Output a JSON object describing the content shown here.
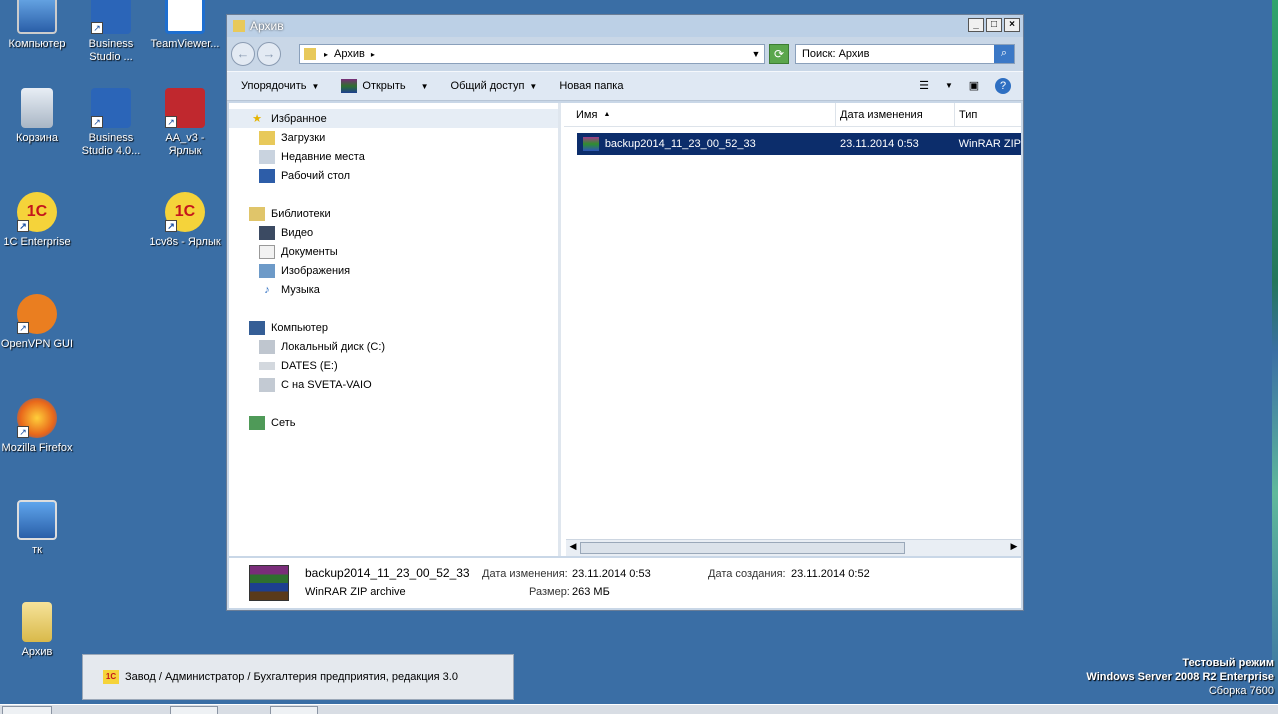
{
  "desktop": {
    "icons": [
      {
        "label": "Компьютер",
        "icon": "computer-icon"
      },
      {
        "label": "Business Studio ...",
        "icon": "business-studio-icon"
      },
      {
        "label": "TeamViewer...",
        "icon": "teamviewer-icon"
      },
      {
        "label": "Корзина",
        "icon": "recycle-bin-icon"
      },
      {
        "label": "Business Studio 4.0...",
        "icon": "business-studio-icon"
      },
      {
        "label": "AA_v3 - Ярлык",
        "icon": "ammyy-admin-icon"
      },
      {
        "label": "1C Enterprise",
        "icon": "1c-icon"
      },
      {
        "label": "1cv8s - Ярлык",
        "icon": "1c-icon"
      },
      {
        "label": "OpenVPN GUI",
        "icon": "openvpn-icon"
      },
      {
        "label": "Mozilla Firefox",
        "icon": "firefox-icon"
      },
      {
        "label": "тк",
        "icon": "remote-desktop-icon"
      },
      {
        "label": "Архив",
        "icon": "folder-icon"
      }
    ]
  },
  "window": {
    "title": "Архив",
    "address_path": "Архив",
    "search_placeholder": "Поиск: Архив",
    "toolbar": {
      "organize": "Упорядочить",
      "open": "Открыть",
      "share": "Общий доступ",
      "new_folder": "Новая папка"
    },
    "nav": {
      "favorites": "Избранное",
      "downloads": "Загрузки",
      "recent": "Недавние места",
      "desktop": "Рабочий стол",
      "libraries": "Библиотеки",
      "video": "Видео",
      "documents": "Документы",
      "images": "Изображения",
      "music": "Музыка",
      "computer": "Компьютер",
      "local_disk": "Локальный диск (C:)",
      "dates": "DATES (E:)",
      "sveta": "C на SVETA-VAIO",
      "network": "Сеть"
    },
    "columns": {
      "name": "Имя",
      "date": "Дата изменения",
      "type": "Тип"
    },
    "files": [
      {
        "name": "backup2014_11_23_00_52_33",
        "date": "23.11.2014 0:53",
        "type": "WinRAR ZIP"
      }
    ],
    "details": {
      "name": "backup2014_11_23_00_52_33",
      "type": "WinRAR ZIP archive",
      "modified_label": "Дата изменения:",
      "modified": "23.11.2014 0:53",
      "created_label": "Дата создания:",
      "created": "23.11.2014 0:52",
      "size_label": "Размер:",
      "size": "263 МБ"
    }
  },
  "background_window": {
    "title": "Завод / Администратор / Бухгалтерия предприятия, редакция 3.0"
  },
  "watermark": {
    "line1": "Тестовый режим",
    "line2": "Windows Server 2008 R2 Enterprise",
    "line3": "Сборка 7600"
  }
}
